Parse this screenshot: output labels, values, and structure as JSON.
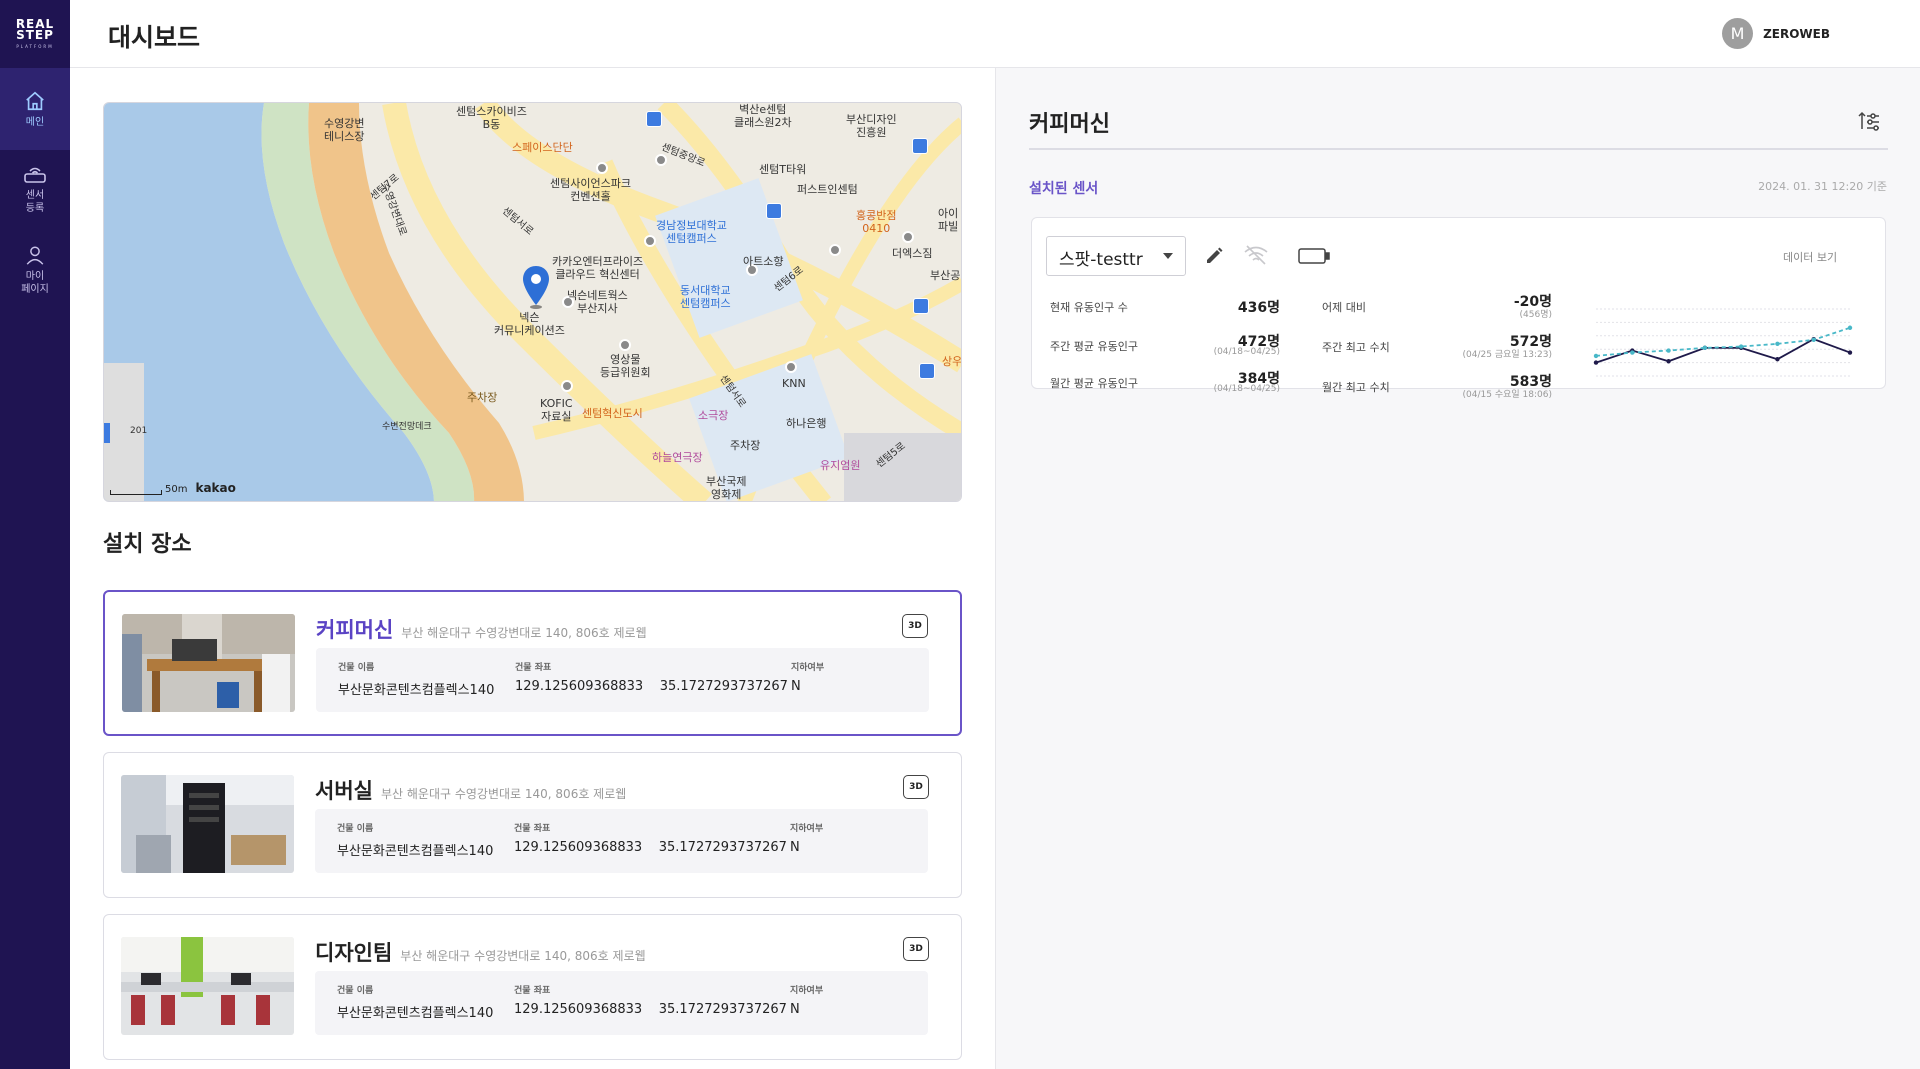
{
  "app": {
    "logo_line1": "REAL",
    "logo_line2": "STEP",
    "logo_tag": "PLATFORM",
    "page_title": "대시보드"
  },
  "user": {
    "avatar_letter": "M",
    "name": "ZEROWEB"
  },
  "sidebar": {
    "items": [
      {
        "label": "메인",
        "icon": "home-icon",
        "active": true
      },
      {
        "label": "센서\n등록",
        "icon": "sensor-icon",
        "active": false
      },
      {
        "label": "마이\n페이지",
        "icon": "person-icon",
        "active": false
      }
    ]
  },
  "map": {
    "labels": [
      "수영강변\n테니스장",
      "센텀스카이비즈\nB동",
      "벽산e센텀\n클래스원2차",
      "부산디자인\n진흥원",
      "스페이스단단",
      "센텀사이언스파크\n컨벤션홀",
      "센텀T타워",
      "퍼스트인센텀",
      "홍콩반점\n0410",
      "아이\n파빌",
      "경남정보대학교\n센텀캠퍼스",
      "더엑스짐",
      "카카오엔터프라이즈\n클라우드 혁신센터",
      "아트소향",
      "넥슨네트웍스\n부산지사",
      "동서대학교\n센텀캠퍼스",
      "넥슨\n커뮤니케이션즈",
      "부산공",
      "영상물\n등급위원회",
      "KNN",
      "주차장",
      "KOFIC\n자료실",
      "센텀혁신도시",
      "소극장",
      "하나은행",
      "수변전망데크",
      "하늘연극장",
      "주차장",
      "유지엄원",
      "부산국제\n영화제",
      "201",
      "센텀중앙로",
      "센텀7로",
      "수영강변대로",
      "센텀서로",
      "센텀6로",
      "센텀5로",
      "센텀서로",
      "상우"
    ],
    "scale": "50m",
    "brand": "kakao"
  },
  "locations": {
    "section_title": "설치 장소",
    "building_name_label": "건물 이름",
    "building_coord_label": "건물 좌표",
    "underground_label": "지하여부",
    "badge_3d": "3D",
    "items": [
      {
        "name": "커피머신",
        "address": "부산 해운대구 수영강변대로 140, 806호 제로웹",
        "building_name": "부산문화콘텐츠컴플렉스140",
        "lng": "129.125609368833",
        "lat": "35.1727293737267",
        "underground": "N",
        "selected": true
      },
      {
        "name": "서버실",
        "address": "부산 해운대구 수영강변대로 140, 806호 제로웹",
        "building_name": "부산문화콘텐츠컴플렉스140",
        "lng": "129.125609368833",
        "lat": "35.1727293737267",
        "underground": "N",
        "selected": false
      },
      {
        "name": "디자인팀",
        "address": "부산 해운대구 수영강변대로 140, 806호 제로웹",
        "building_name": "부산문화콘텐츠컴플렉스140",
        "lng": "129.125609368833",
        "lat": "35.1727293737267",
        "underground": "N",
        "selected": false
      }
    ]
  },
  "detail": {
    "title": "커피머신",
    "installed_sensors": "설치된 센서",
    "timestamp": "2024. 01. 31 12:20 기준",
    "sensor_name": "스팟-testtr",
    "data_link": "데이터 보기",
    "stats": {
      "current_label": "현재 유동인구 수",
      "current_value": "436명",
      "yesterday_label": "어제 대비",
      "yesterday_value": "-20명",
      "yesterday_sub": "(456명)",
      "weekly_avg_label": "주간 평균 유동인구",
      "weekly_avg_value": "472명",
      "weekly_avg_sub": "(04/18~04/25)",
      "weekly_max_label": "주간 최고 수치",
      "weekly_max_value": "572명",
      "weekly_max_sub": "(04/25 금요일 13:23)",
      "monthly_avg_label": "월간 평균 유동인구",
      "monthly_avg_value": "384명",
      "monthly_avg_sub": "(04/18~04/25)",
      "monthly_max_label": "월간 최고 수치",
      "monthly_max_value": "583명",
      "monthly_max_sub": "(04/15 수요일 18:06)"
    }
  },
  "chart_data": {
    "type": "line",
    "x": [
      1,
      2,
      3,
      4,
      5,
      6,
      7,
      8
    ],
    "ylim": [
      0,
      100
    ],
    "series": [
      {
        "values": [
          20,
          38,
          22,
          42,
          42,
          25,
          55,
          35
        ],
        "color": "#1f1a4a",
        "style": "solid"
      },
      {
        "values": [
          30,
          35,
          38,
          42,
          44,
          48,
          54,
          72
        ],
        "color": "#49b8c8",
        "style": "dashed"
      }
    ],
    "grid": true,
    "title": "",
    "xlabel": "",
    "ylabel": ""
  }
}
